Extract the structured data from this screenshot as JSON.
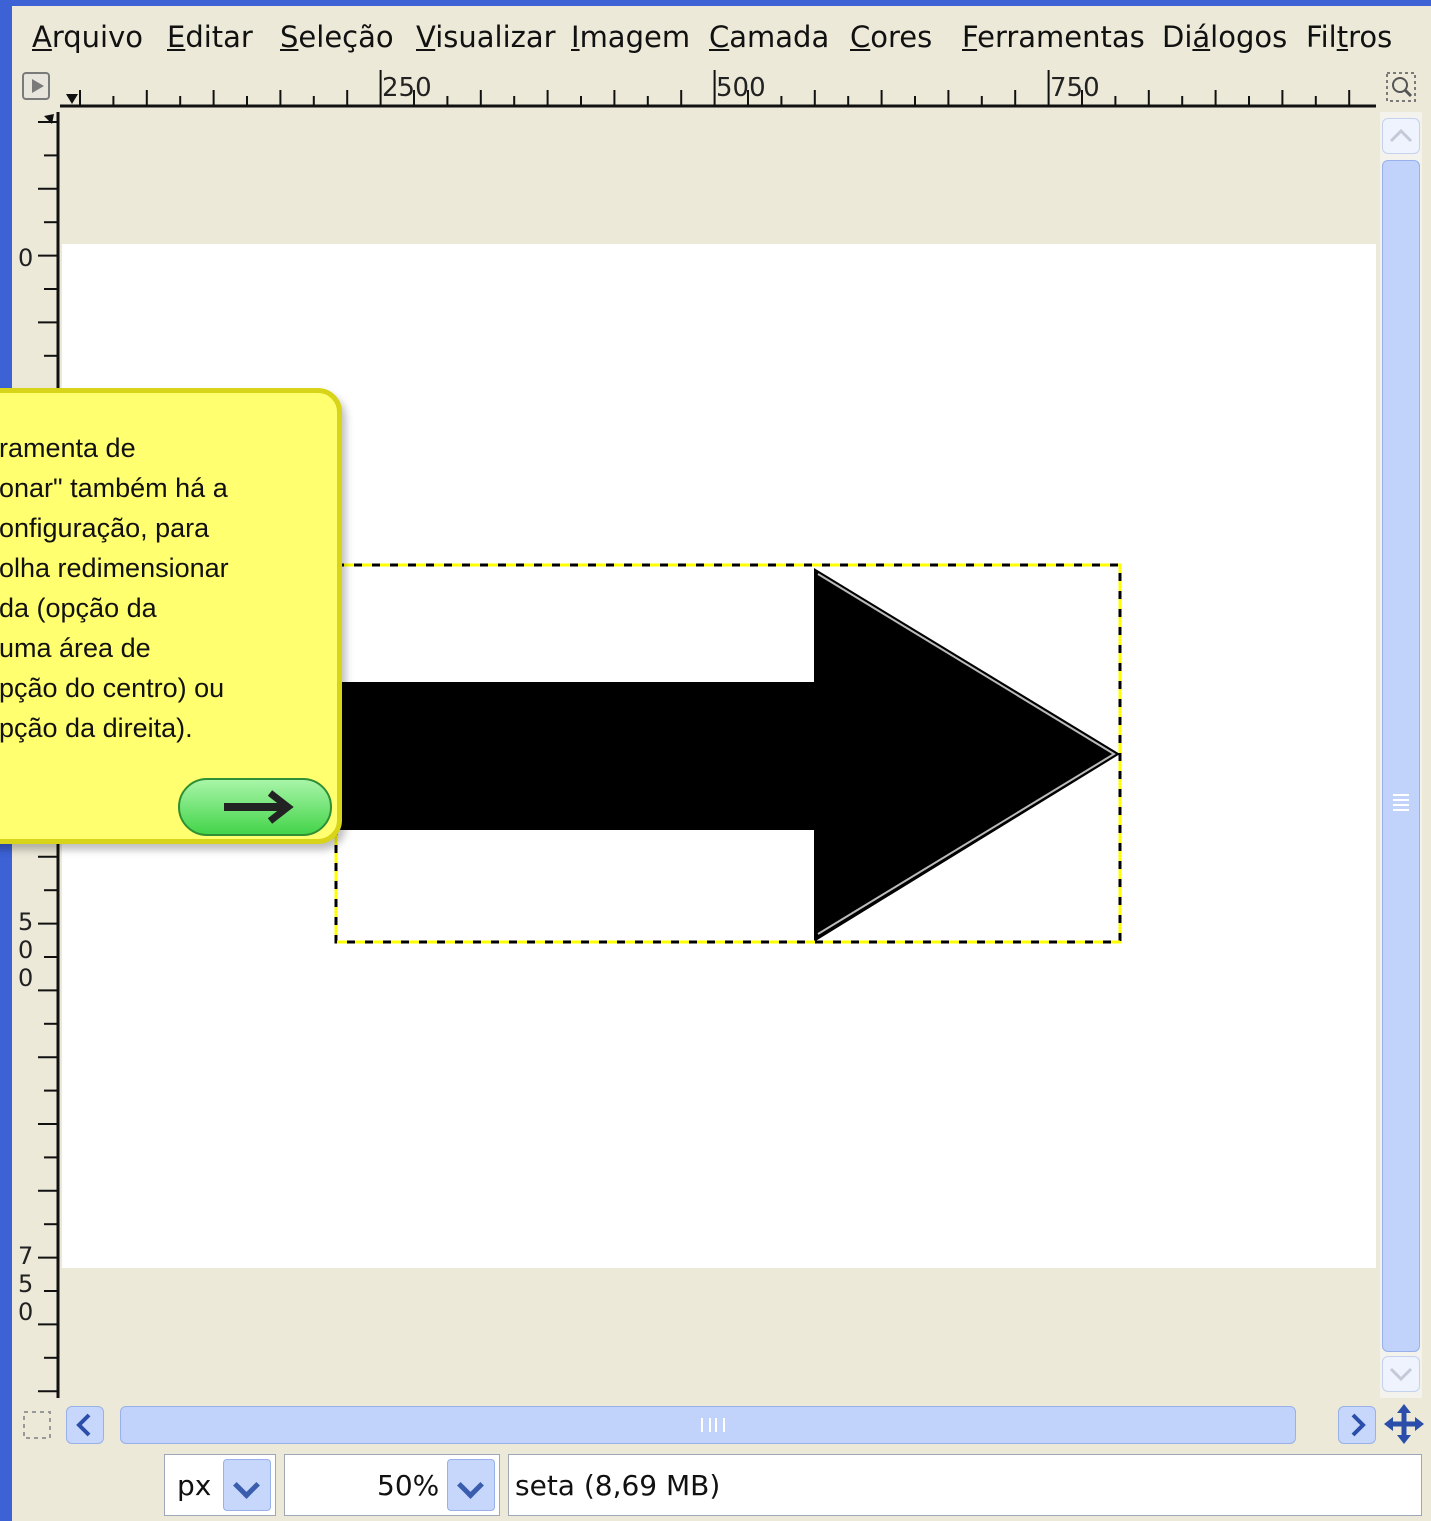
{
  "menubar": {
    "items": [
      {
        "label": "Arquivo",
        "mnemonic": "A",
        "rest": "rquivo"
      },
      {
        "label": "Editar",
        "mnemonic": "E",
        "rest": "ditar"
      },
      {
        "label": "Seleção",
        "mnemonic": "S",
        "rest": "eleção"
      },
      {
        "label": "Visualizar",
        "mnemonic": "V",
        "rest": "isualizar"
      },
      {
        "label": "Imagem",
        "mnemonic": "I",
        "rest": "magem"
      },
      {
        "label": "Camada",
        "mnemonic": "C",
        "rest": "amada"
      },
      {
        "label": "Cores",
        "mnemonic": "C",
        "rest": "ores"
      },
      {
        "label": "Ferramentas",
        "mnemonic": "F",
        "rest": "erramentas"
      },
      {
        "label": "Diálogos",
        "pre": "Di",
        "mnemonic": "á",
        "rest": "logos"
      },
      {
        "label": "Filtros",
        "pre": "Fil",
        "mnemonic": "t",
        "rest": "ros"
      }
    ]
  },
  "rulers": {
    "horizontal_labels": [
      "250",
      "500",
      "750"
    ],
    "vertical_labels": [
      "0",
      "500",
      "750"
    ]
  },
  "tooltip": {
    "lines": [
      "ramenta de",
      "onar\" também há a",
      "onfiguração, para",
      "olha redimensionar",
      "da (opção da",
      "uma área de",
      "pção do centro) ou",
      "pção da direita)."
    ],
    "next_icon": "right-arrow-icon"
  },
  "statusbar": {
    "unit": "px",
    "zoom": "50%",
    "status": "seta (8,69 MB)"
  },
  "colors": {
    "window_border": "#3c62d6",
    "background": "#ece9d8",
    "tooltip_bg": "#ffff70",
    "tooltip_border": "#d8d41a",
    "selection_dash": "#ffff00",
    "scrollbar": "#c1d3fb"
  }
}
